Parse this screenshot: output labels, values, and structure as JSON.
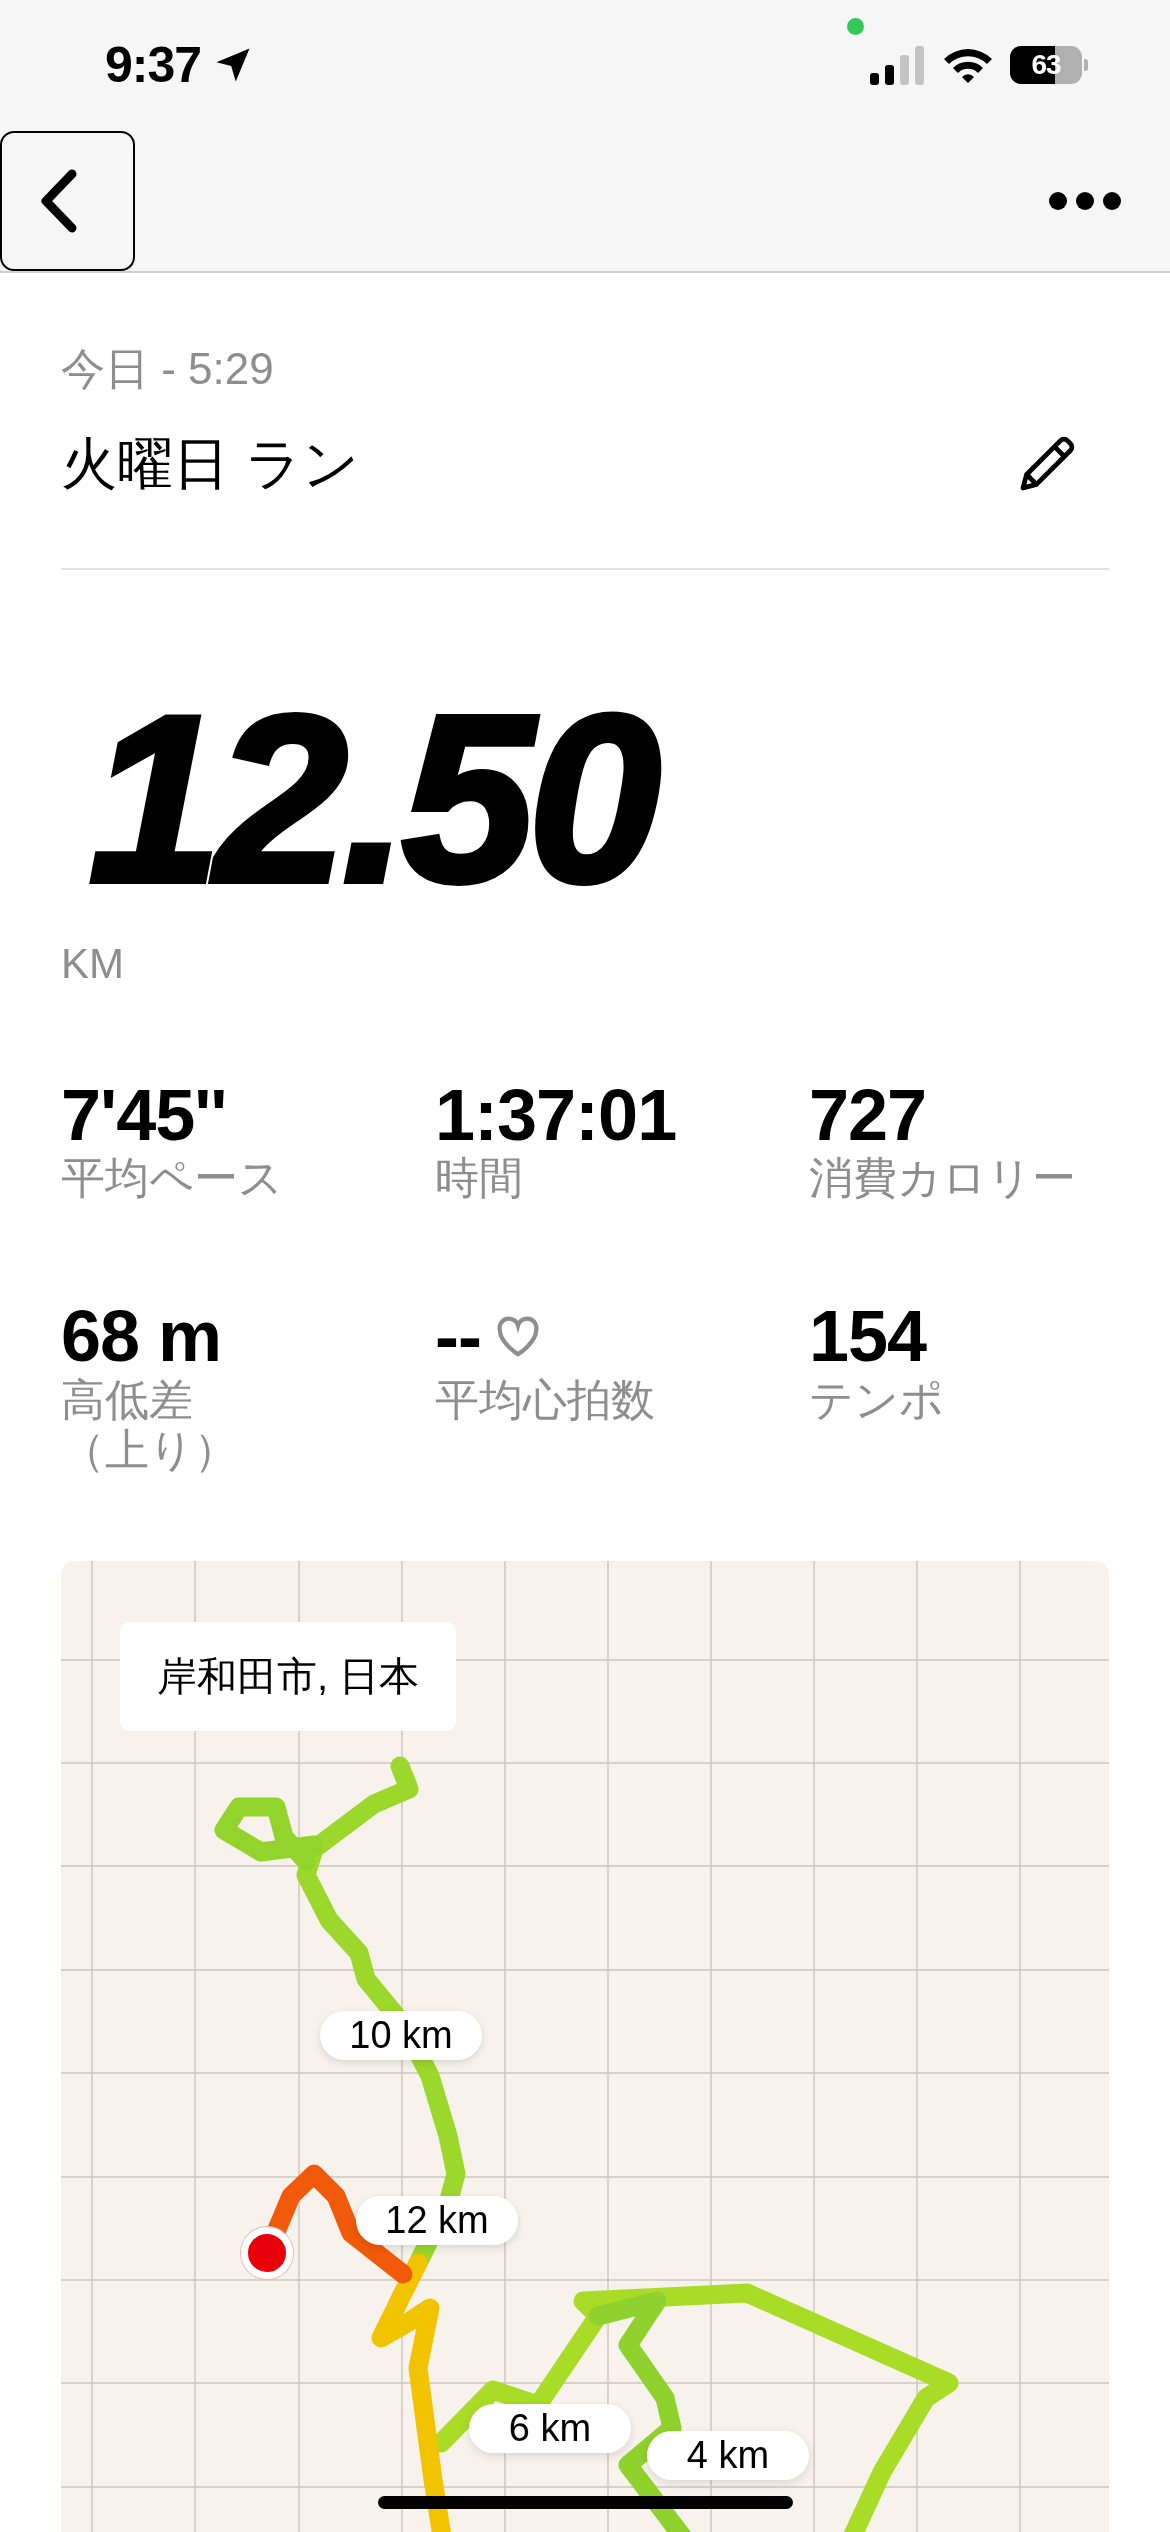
{
  "status_bar": {
    "time": "9:37",
    "battery": "63"
  },
  "nav": {
    "back_focused": true
  },
  "activity": {
    "date": "今日 - 5:29",
    "title": "火曜日 ラン"
  },
  "distance": {
    "value": "12.50",
    "unit": "KM"
  },
  "stats": [
    {
      "kind": "plain",
      "value": "7'45''",
      "label": "平均ペース"
    },
    {
      "kind": "plain",
      "value": "1:37:01",
      "label": "時間"
    },
    {
      "kind": "plain",
      "value": "727",
      "label": "消費カロリー"
    },
    {
      "kind": "plain",
      "value": "68 m",
      "label": "高低差（上り）"
    },
    {
      "kind": "heart",
      "value": "--",
      "label": "平均心拍数"
    },
    {
      "kind": "plain",
      "value": "154",
      "label": "テンポ"
    }
  ],
  "map": {
    "location": "岸和田市, 日本",
    "markers": [
      {
        "label": "10 km"
      },
      {
        "label": "12 km"
      },
      {
        "label": "6 km"
      },
      {
        "label": "4 km"
      }
    ]
  }
}
